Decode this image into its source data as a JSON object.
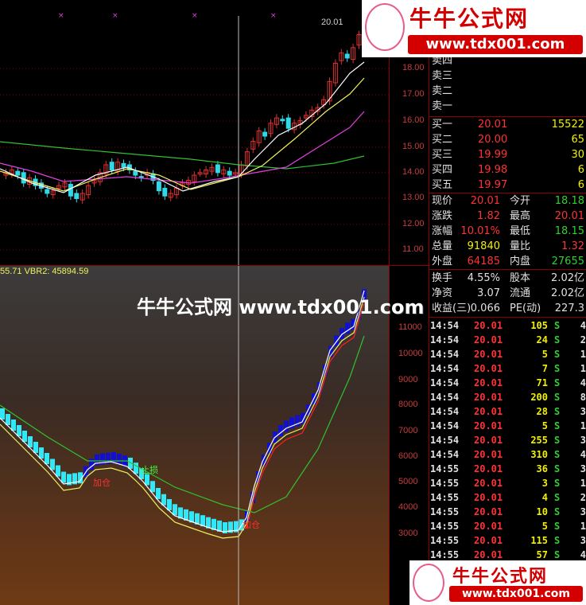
{
  "colors": {
    "background": "#000000",
    "divider": "#8b0000",
    "up_candle": "#e03030",
    "down_candle": "#30d8e8",
    "ma_white": "#ffffff",
    "ma_yellow": "#f0f060",
    "ma_magenta": "#e040e0",
    "ma_green": "#30c030",
    "price_red": "#ff3333",
    "price_green": "#30d030",
    "price_yellow": "#f0f000",
    "label_white": "#e0e0e0"
  },
  "main_chart": {
    "current_price_label": "20.01",
    "price_axis": [
      "18.00",
      "17.00",
      "16.00",
      "15.00",
      "14.00",
      "13.00",
      "12.00",
      "11.00"
    ]
  },
  "indicator": {
    "values_text": "55.71  VBR2: 45894.59",
    "axis": [
      "11000",
      "10000",
      "9000",
      "8000",
      "7000",
      "6000",
      "5000",
      "4000",
      "3000"
    ],
    "annotations": {
      "stop_loss": "止损",
      "add_position_1": "加仓",
      "add_position_2": "加仓"
    }
  },
  "watermark": {
    "overlay_text": "牛牛公式网 www.tdx001.com",
    "logo_title": "牛牛公式网",
    "logo_url": "www.tdx001.com"
  },
  "order_book": {
    "asks": [
      {
        "label": "卖四"
      },
      {
        "label": "卖三"
      },
      {
        "label": "卖二"
      },
      {
        "label": "卖一"
      }
    ],
    "bids": [
      {
        "label": "买一",
        "price": "20.01",
        "vol": "15522"
      },
      {
        "label": "买二",
        "price": "20.00",
        "vol": "65"
      },
      {
        "label": "买三",
        "price": "19.99",
        "vol": "30"
      },
      {
        "label": "买四",
        "price": "19.98",
        "vol": "6"
      },
      {
        "label": "买五",
        "price": "19.97",
        "vol": "6"
      }
    ]
  },
  "quote": [
    {
      "l1": "现价",
      "v1": "20.01",
      "l2": "今开",
      "v2": "18.18"
    },
    {
      "l1": "涨跌",
      "v1": "1.82",
      "l2": "最高",
      "v2": "20.01"
    },
    {
      "l1": "涨幅",
      "v1": "10.01%",
      "l2": "最低",
      "v2": "18.15"
    },
    {
      "l1": "总量",
      "v1": "91840",
      "l2": "量比",
      "v2": "1.32"
    },
    {
      "l1": "外盘",
      "v1": "64185",
      "l2": "内盘",
      "v2": "27655"
    }
  ],
  "stats": [
    {
      "l1": "换手",
      "v1": "4.55%",
      "l2": "股本",
      "v2": "2.02亿"
    },
    {
      "l1": "净资",
      "v1": "3.07",
      "l2": "流通",
      "v2": "2.02亿"
    },
    {
      "l1": "收益(三)",
      "v1": "0.066",
      "l2": "PE(动)",
      "v2": "227.3"
    }
  ],
  "trades": [
    {
      "time": "14:54",
      "price": "20.01",
      "vol": "105",
      "side": "S",
      "n": "4"
    },
    {
      "time": "14:54",
      "price": "20.01",
      "vol": "24",
      "side": "S",
      "n": "2"
    },
    {
      "time": "14:54",
      "price": "20.01",
      "vol": "5",
      "side": "S",
      "n": "1"
    },
    {
      "time": "14:54",
      "price": "20.01",
      "vol": "7",
      "side": "S",
      "n": "1"
    },
    {
      "time": "14:54",
      "price": "20.01",
      "vol": "71",
      "side": "S",
      "n": "4"
    },
    {
      "time": "14:54",
      "price": "20.01",
      "vol": "200",
      "side": "S",
      "n": "8"
    },
    {
      "time": "14:54",
      "price": "20.01",
      "vol": "28",
      "side": "S",
      "n": "3"
    },
    {
      "time": "14:54",
      "price": "20.01",
      "vol": "5",
      "side": "S",
      "n": "1"
    },
    {
      "time": "14:54",
      "price": "20.01",
      "vol": "255",
      "side": "S",
      "n": "3"
    },
    {
      "time": "14:54",
      "price": "20.01",
      "vol": "310",
      "side": "S",
      "n": "4"
    },
    {
      "time": "14:55",
      "price": "20.01",
      "vol": "36",
      "side": "S",
      "n": "3"
    },
    {
      "time": "14:55",
      "price": "20.01",
      "vol": "3",
      "side": "S",
      "n": "1"
    },
    {
      "time": "14:55",
      "price": "20.01",
      "vol": "4",
      "side": "S",
      "n": "2"
    },
    {
      "time": "14:55",
      "price": "20.01",
      "vol": "10",
      "side": "S",
      "n": "3"
    },
    {
      "time": "14:55",
      "price": "20.01",
      "vol": "5",
      "side": "S",
      "n": "1"
    },
    {
      "time": "14:55",
      "price": "20.01",
      "vol": "115",
      "side": "S",
      "n": "3"
    },
    {
      "time": "14:55",
      "price": "20.01",
      "vol": "57",
      "side": "S",
      "n": "4"
    }
  ]
}
